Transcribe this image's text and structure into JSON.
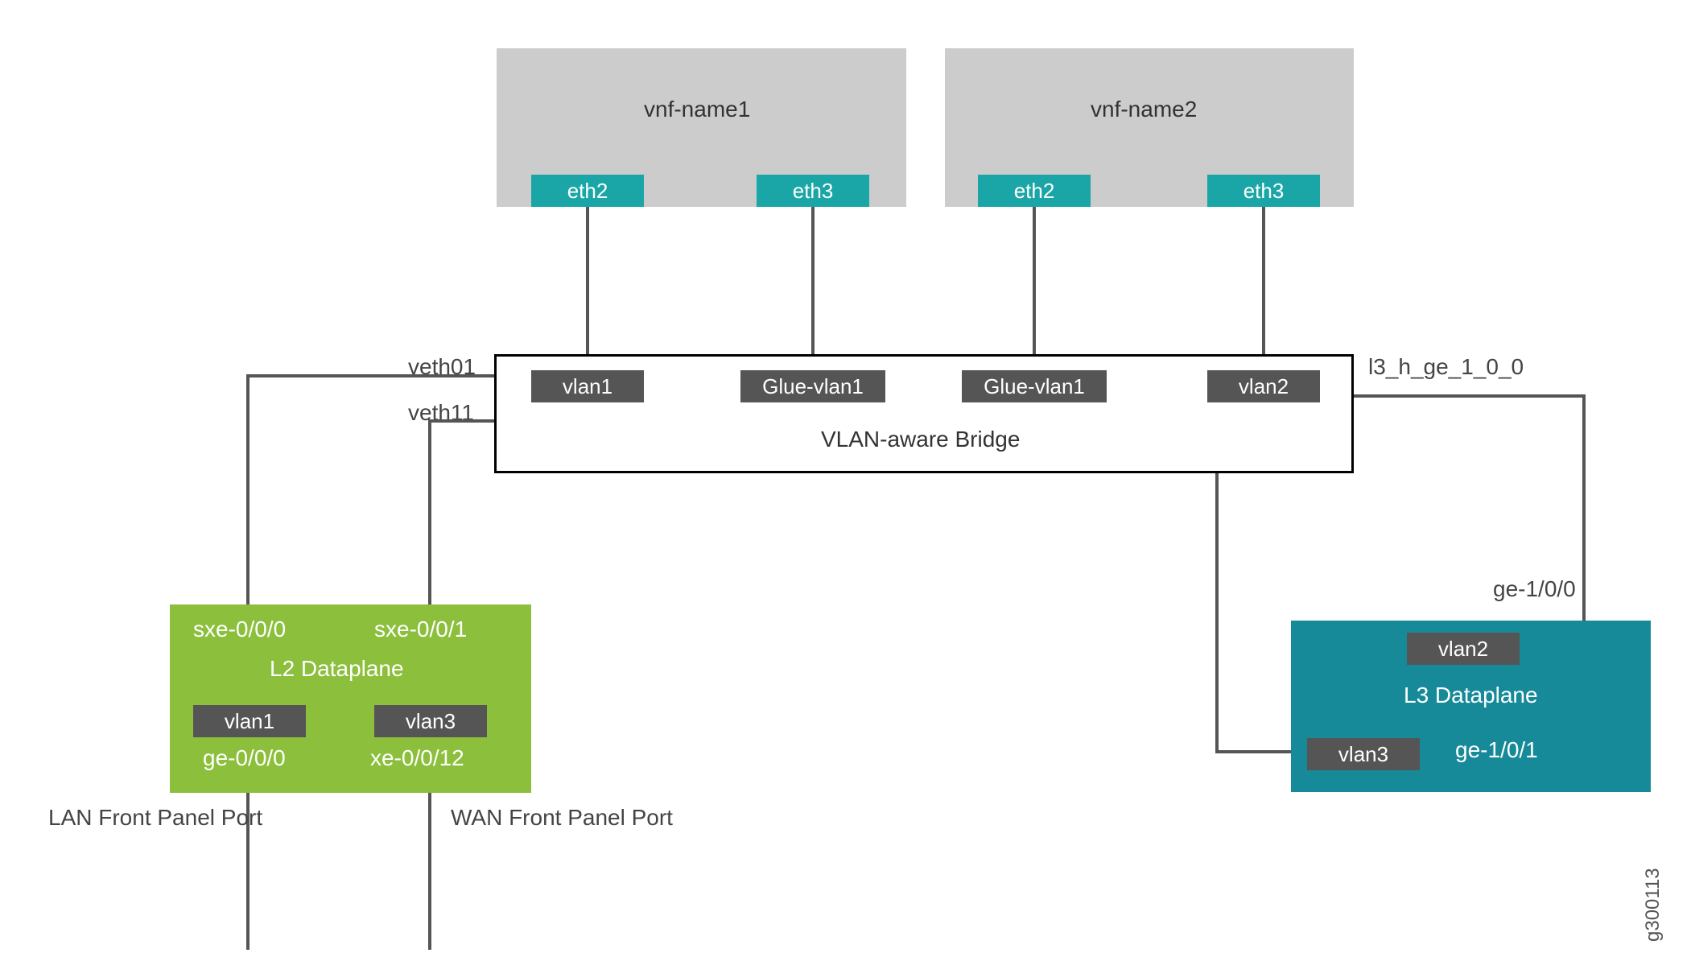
{
  "vnf1": {
    "title": "vnf-name1",
    "eth_a": "eth2",
    "eth_b": "eth3"
  },
  "vnf2": {
    "title": "vnf-name2",
    "eth_a": "eth2",
    "eth_b": "eth3"
  },
  "bridge": {
    "title": "VLAN-aware Bridge",
    "ports": {
      "p1": "vlan1",
      "p2": "Glue-vlan1",
      "p3": "Glue-vlan1",
      "p4": "vlan2"
    }
  },
  "left_labels": {
    "veth01": "veth01",
    "veth11": "veth11"
  },
  "right_labels": {
    "l3h": "l3_h_ge_1_0_0",
    "ge100": "ge-1/0/0"
  },
  "l2": {
    "title": "L2 Dataplane",
    "sxe0": "sxe-0/0/0",
    "sxe1": "sxe-0/0/1",
    "vlan1": "vlan1",
    "vlan3": "vlan3",
    "ge000": "ge-0/0/0",
    "xe0012": "xe-0/0/12"
  },
  "l3": {
    "title": "L3 Dataplane",
    "vlan2": "vlan2",
    "vlan3": "vlan3",
    "ge101": "ge-1/0/1"
  },
  "footer": {
    "lan": "LAN Front Panel Port",
    "wan": "WAN Front Panel Port"
  },
  "footnote": "g300113"
}
